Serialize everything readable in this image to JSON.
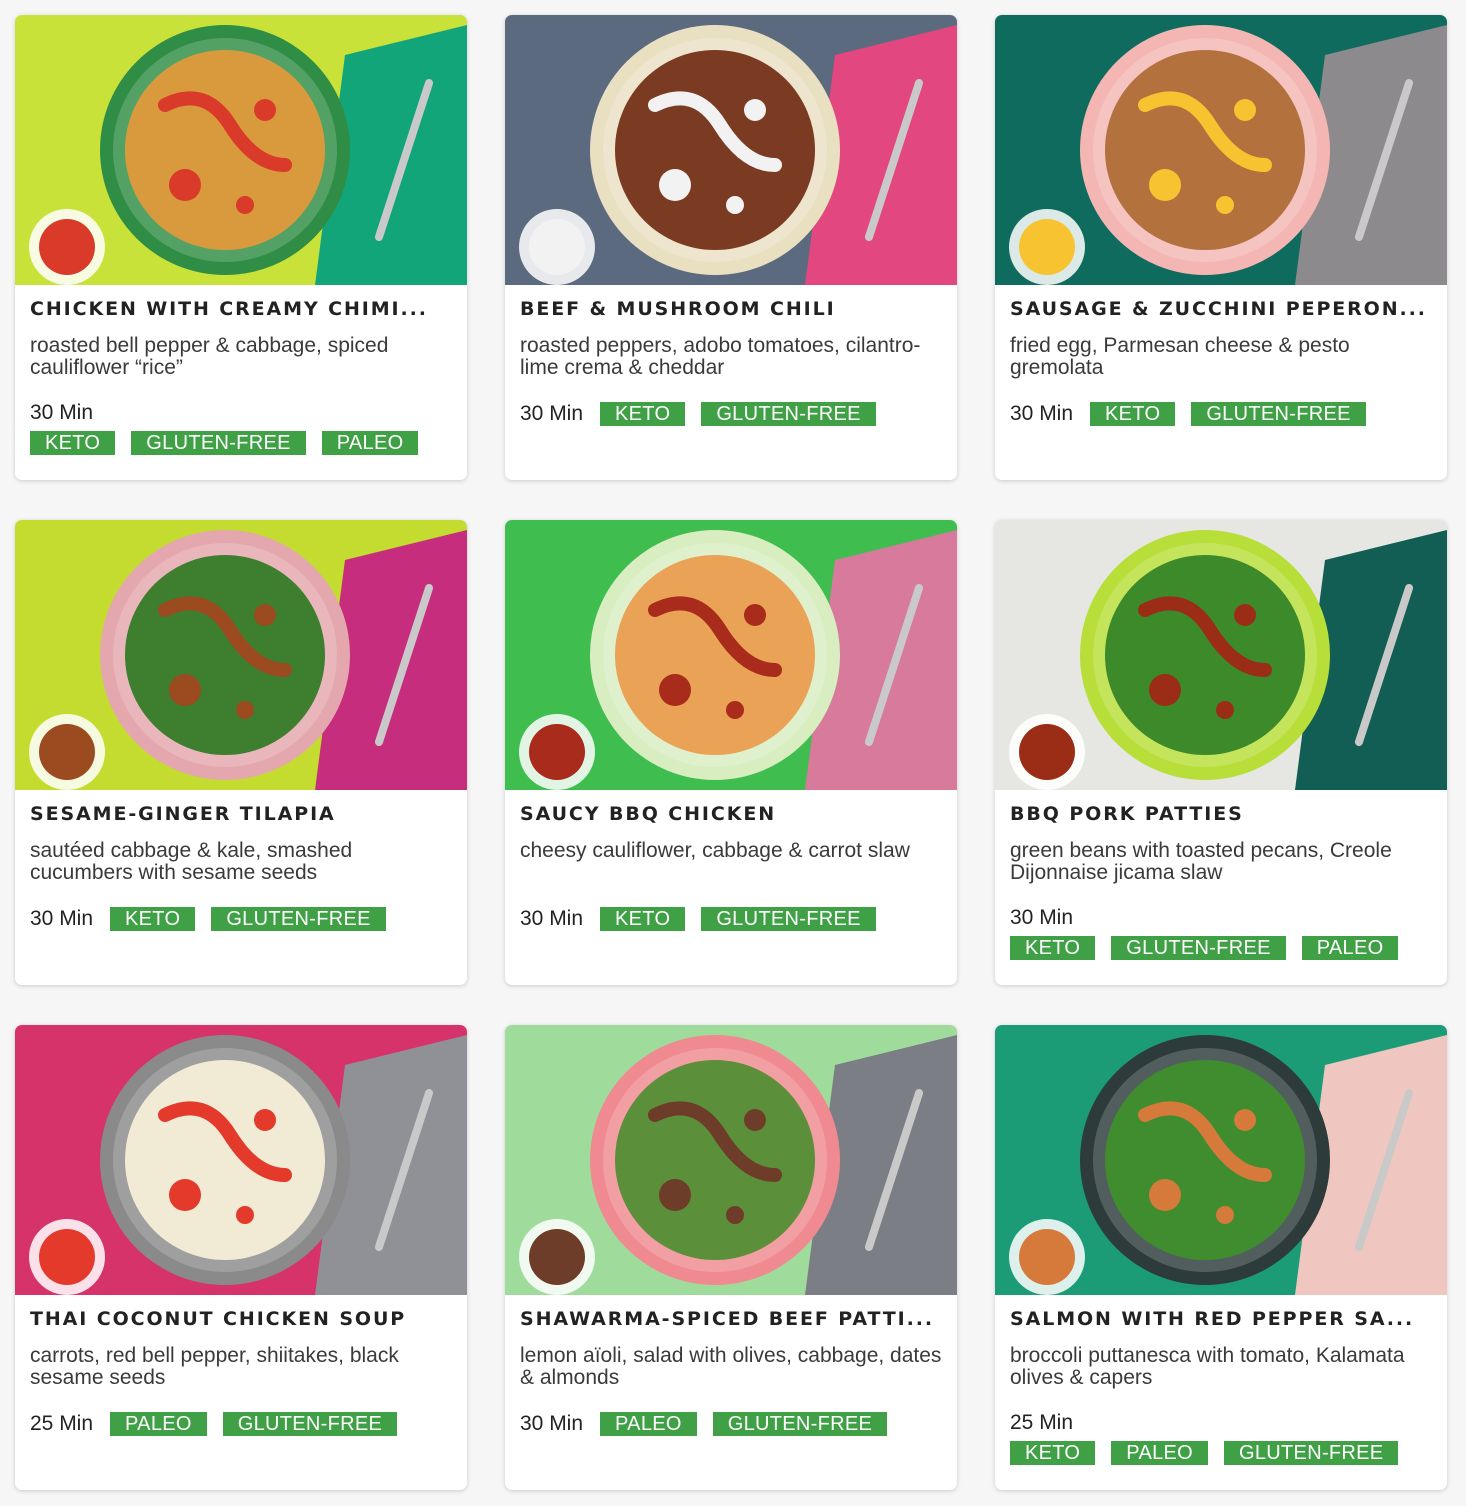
{
  "colors": {
    "tag_green": "#3fa046"
  },
  "cards": [
    {
      "title": "CHICKEN WITH CREAMY CHIMI...",
      "desc": "roasted bell pepper & cabbage, spiced cauliflower “rice”",
      "time": "30 Min",
      "tags": [
        "KETO",
        "GLUTEN-FREE",
        "PALEO"
      ],
      "photo": {
        "bg": "#c9e23a",
        "bowl": "#2f8d45",
        "food": "#d89a3c",
        "accent": "#d93a2a",
        "cloth": "#13a57a"
      }
    },
    {
      "title": "BEEF & MUSHROOM CHILI",
      "desc": "roasted peppers, adobo tomatoes, cilantro-lime crema & cheddar",
      "time": "30 Min",
      "tags": [
        "KETO",
        "GLUTEN-FREE"
      ],
      "photo": {
        "bg": "#5c6a80",
        "bowl": "#e9e0c2",
        "food": "#7a3b22",
        "accent": "#f2f2f2",
        "cloth": "#e2477f"
      }
    },
    {
      "title": "SAUSAGE & ZUCCHINI PEPERON...",
      "desc": "fried egg, Parmesan cheese & pesto gremolata",
      "time": "30 Min",
      "tags": [
        "KETO",
        "GLUTEN-FREE"
      ],
      "photo": {
        "bg": "#0f6b5e",
        "bowl": "#f3b6b3",
        "food": "#b3713e",
        "accent": "#f7c331",
        "cloth": "#8d8a8d"
      }
    },
    {
      "title": "SESAME-GINGER TILAPIA",
      "desc": "sautéed cabbage & kale, smashed cucumbers with sesame seeds",
      "time": "30 Min",
      "tags": [
        "KETO",
        "GLUTEN-FREE"
      ],
      "photo": {
        "bg": "#c4dc2f",
        "bowl": "#e3a7ad",
        "food": "#3d7f2f",
        "accent": "#9b4b1f",
        "cloth": "#c72d7d"
      }
    },
    {
      "title": "SAUCY BBQ CHICKEN",
      "desc": "cheesy cauliflower, cabbage & carrot slaw",
      "time": "30 Min",
      "tags": [
        "KETO",
        "GLUTEN-FREE"
      ],
      "photo": {
        "bg": "#3fbd4f",
        "bowl": "#d8eec1",
        "food": "#e9a256",
        "accent": "#a82b1c",
        "cloth": "#d77a9b"
      }
    },
    {
      "title": "BBQ PORK PATTIES",
      "desc": "green beans with toasted pecans, Creole Dijonnaise jicama slaw",
      "time": "30 Min",
      "tags": [
        "KETO",
        "GLUTEN-FREE",
        "PALEO"
      ],
      "photo": {
        "bg": "#e6e6e2",
        "bowl": "#b7de39",
        "food": "#3d8a2b",
        "accent": "#9b2d17",
        "cloth": "#125e55"
      }
    },
    {
      "title": "THAI COCONUT CHICKEN SOUP",
      "desc": "carrots, red bell pepper, shiitakes, black sesame seeds",
      "time": "25 Min",
      "tags": [
        "PALEO",
        "GLUTEN-FREE"
      ],
      "photo": {
        "bg": "#d6336a",
        "bowl": "#8a8a8a",
        "food": "#f1ead4",
        "accent": "#e33a2c",
        "cloth": "#8f9196"
      }
    },
    {
      "title": "SHAWARMA-SPICED BEEF PATTI...",
      "desc": "lemon aïoli, salad with olives, cabbage, dates & almonds",
      "time": "30 Min",
      "tags": [
        "PALEO",
        "GLUTEN-FREE"
      ],
      "photo": {
        "bg": "#9fdc9c",
        "bowl": "#f08a91",
        "food": "#5b8f3a",
        "accent": "#6e3d2a",
        "cloth": "#7c7e86"
      }
    },
    {
      "title": "SALMON WITH RED PEPPER SA...",
      "desc": "broccoli puttanesca with tomato, Kalamata olives & capers",
      "time": "25 Min",
      "tags": [
        "KETO",
        "PALEO",
        "GLUTEN-FREE"
      ],
      "photo": {
        "bg": "#1c9b77",
        "bowl": "#2d3b3a",
        "food": "#3f8d2e",
        "accent": "#d57a3b",
        "cloth": "#f0c7c0"
      }
    }
  ]
}
